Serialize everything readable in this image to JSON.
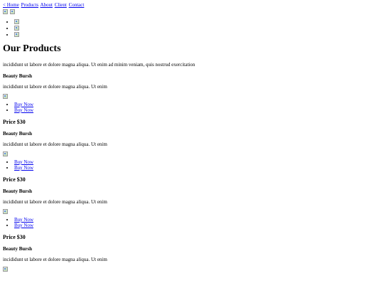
{
  "nav": {
    "items": [
      "< Home",
      "Products",
      "About",
      "Client",
      "Contact"
    ]
  },
  "hero": {
    "icons": [
      "broken-image-icon",
      "broken-image-icon"
    ]
  },
  "social": {
    "icons": [
      "broken-image-icon",
      "broken-image-icon",
      "broken-image-icon"
    ]
  },
  "main": {
    "title": "Our Products",
    "intro": "incididunt ut labore et dolore magna aliqua. Ut enim ad minim veniam, quis nostrud exercitation"
  },
  "products": [
    {
      "name": "Beauty Bursh",
      "desc": "incididunt ut labore et dolore magna aliqua. Ut enim",
      "buy1": "Buy Now",
      "buy2": "Buy Now",
      "price": "Price $30"
    },
    {
      "name": "Beauty Bursh",
      "desc": "incididunt ut labore et dolore magna aliqua. Ut enim",
      "buy1": "Buy Now",
      "buy2": "Buy Now",
      "price": "Price $30"
    },
    {
      "name": "Beauty Bursh",
      "desc": "incididunt ut labore et dolore magna aliqua. Ut enim",
      "buy1": "Buy Now",
      "buy2": "Buy Now",
      "price": "Price $30"
    },
    {
      "name": "Beauty Bursh",
      "desc": "incididunt ut labore et dolore magna aliqua. Ut enim"
    }
  ],
  "colors": {
    "link": "#0000ee",
    "text": "#000000",
    "background": "#ffffff"
  }
}
